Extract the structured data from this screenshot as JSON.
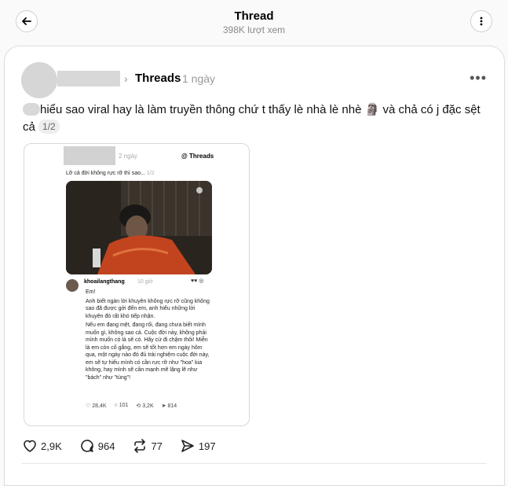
{
  "header": {
    "title": "Thread",
    "views": "398K lượt xem"
  },
  "post": {
    "community": "Threads",
    "time": "1 ngày",
    "text_main": "hiểu sao viral hay là làm truyền thông chứ t thấy lè nhà lè nhè 🗿 và chả có j đặc sệt",
    "text_tail": "cả",
    "pager": "1/2",
    "stats": {
      "likes": "2,9K",
      "replies": "964",
      "reposts": "77",
      "shares": "197"
    }
  },
  "embedded": {
    "time": "2 ngày",
    "brand": "Threads",
    "caption": "Lỡ cả đời không rực rỡ thì sao...",
    "caption_pager": "1/2",
    "reply": {
      "username": "khoailangthang",
      "time": "10 giờ",
      "greeting": "Em!",
      "paragraphs": [
        "Anh biết ngàn lời khuyên không rực rỡ cũng không sao đã được gởi đến em, anh hiểu những lời khuyên đó rất khó tiếp nhận.",
        "Nếu em đang mệt, đang rối, đang chưa biết mình muốn gì, không sao cả. Cuộc đời này, không phải mình muốn có là sẽ có. Hãy cứ đi chậm thôi! Miễn là em còn cố gắng, em sẽ tốt hơn em ngày hôm qua, một ngày nào đó đủ trải nghiệm cuộc đời này, em sẽ tự hiểu mình có cần rực rỡ như \"hoa\" kia không, hay mình sẽ cần mạnh mẽ lặng lẽ như \"bách\" như \"tùng\"!"
      ],
      "stats": {
        "likes": "28,4K",
        "replies": "101",
        "reposts": "3,2K",
        "shares": "814"
      }
    }
  }
}
